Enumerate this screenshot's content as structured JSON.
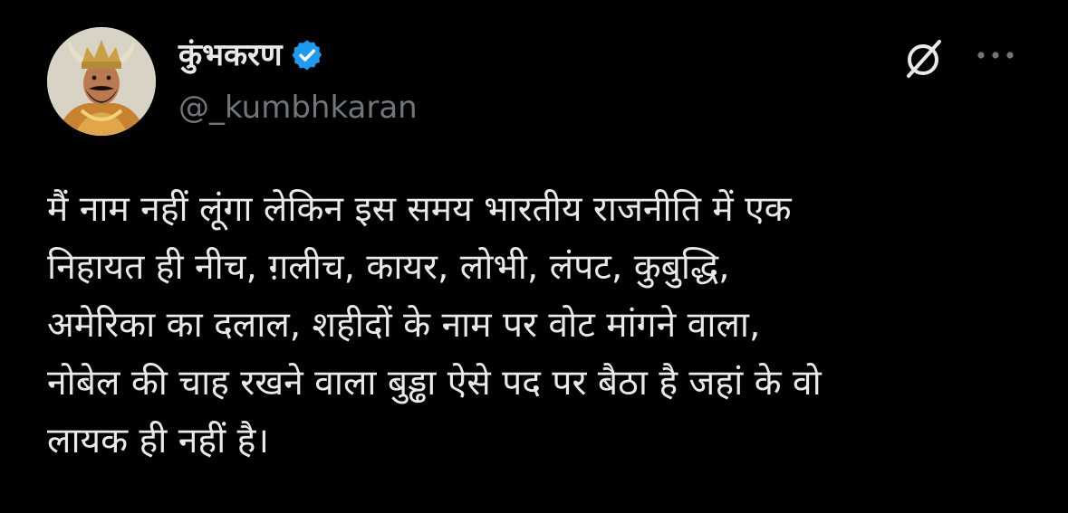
{
  "author": {
    "display_name": "कुंभकरण",
    "handle": "@_kumbhkaran",
    "verified": true
  },
  "icons": {
    "verified": "verified-badge-icon",
    "grok": "grok-icon",
    "more": "more-options-icon"
  },
  "colors": {
    "background": "#000000",
    "text": "#e7e9ea",
    "secondary_text": "#71767b",
    "verified_blue": "#1d9bf0"
  },
  "tweet": {
    "lines": [
      "मैं नाम नहीं लूंगा लेकिन इस समय भारतीय राजनीति में एक",
      "निहायत ही नीच, ग़लीच, कायर, लोभी, लंपट, कुबुद्धि,",
      "अमेरिका का दलाल, शहीदों के नाम पर वोट मांगने वाला,",
      "नोबेल की चाह रखने वाला बुड्ढा ऐसे पद पर बैठा है जहां के वो",
      "लायक ही नहीं है।"
    ]
  }
}
